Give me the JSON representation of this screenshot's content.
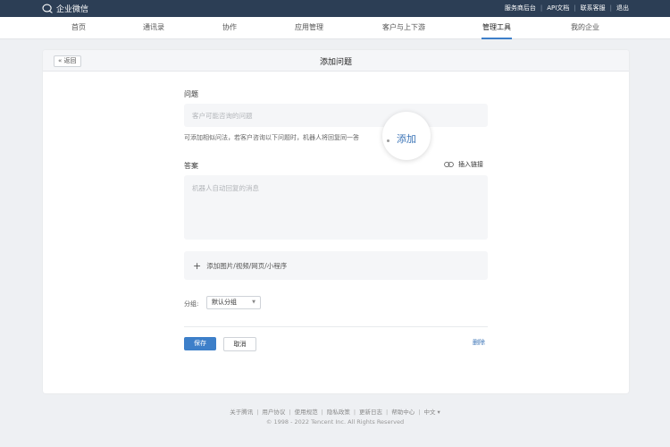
{
  "topbar": {
    "logo_text": "企业微信",
    "links": [
      "服务商后台",
      "API文档",
      "联系客服",
      "退出"
    ]
  },
  "nav": {
    "items": [
      "首页",
      "通讯录",
      "协作",
      "应用管理",
      "客户与上下游",
      "管理工具",
      "我的企业"
    ],
    "active": "管理工具"
  },
  "card": {
    "back_label": "« 返回",
    "title": "添加问题"
  },
  "form": {
    "question_label": "问题",
    "question_placeholder": "客户可能咨询的问题",
    "similar_hint": "可添加相似问法，若客户咨询以下问题时，机器人将回复同一答",
    "add_label": "添加",
    "answer_label": "答案",
    "insert_link_label": "插入链接",
    "answer_placeholder": "机器人自动回复的消息",
    "attach_plus": "+",
    "attach_label": "添加图片/视频/网页/小程序",
    "group_label": "分组:",
    "group_value": "默认分组",
    "save_label": "保存",
    "cancel_label": "取消",
    "delete_label": "删除"
  },
  "footer": {
    "links": [
      "关于腾讯",
      "用户协议",
      "使用规范",
      "隐私政策",
      "更新日志",
      "帮助中心",
      "中文 ▾"
    ],
    "copyright": "© 1998 - 2022 Tencent Inc. All Rights Reserved"
  },
  "colors": {
    "topbar": "#2c3e55",
    "accent": "#3d7fc9",
    "link": "#3a73b6",
    "page_bg": "#eef0f3"
  },
  "icons": [
    "wecom-logo-icon",
    "link-icon",
    "plus-icon",
    "caret-down-icon"
  ]
}
